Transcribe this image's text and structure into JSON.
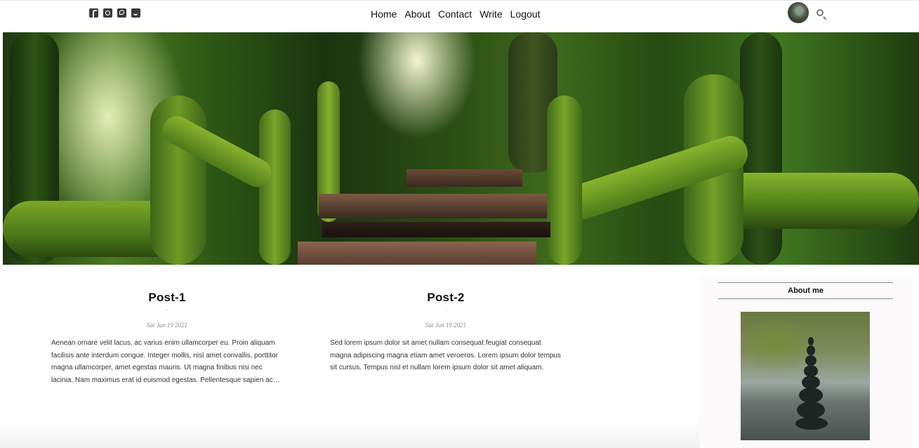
{
  "nav": {
    "social_icons": [
      "facebook-icon",
      "instagram-icon",
      "pinterest-icon",
      "twitter-icon"
    ],
    "links": [
      "Home",
      "About",
      "Contact",
      "Write",
      "Logout"
    ]
  },
  "hero": {
    "image": "forest-walkway-photo"
  },
  "posts": [
    {
      "title": "Post-1",
      "date": "Sat Jun 19 2021",
      "excerpt": "Aenean ornare velit lacus, ac varius enim ullamcorper eu. Proin aliquam facilisis ante interdum congue. Integer mollis, nisl amet convallis, porttitor magna ullamcorper, amet egestas mauris. Ut magna finibus nisi nec lacinia. Nam maximus erat id euismod egestas. Pellentesque sapien ac quam"
    },
    {
      "title": "Post-2",
      "date": "Sat Jun 19 2021",
      "excerpt": "Sed lorem ipsum dolor sit amet nullam consequat feugiat consequat magna adipiscing magna etiam amet veroeros. Lorem ipsum dolor tempus sit cursus. Tempus nisl et nullam lorem ipsum dolor sit amet aliquam."
    }
  ],
  "sidebar": {
    "title": "About me",
    "image": "stacked-stones-photo"
  },
  "colors": {
    "accent": "#111111",
    "sidebar_bg": "#fcfafa",
    "divider": "#8a8a8a"
  }
}
